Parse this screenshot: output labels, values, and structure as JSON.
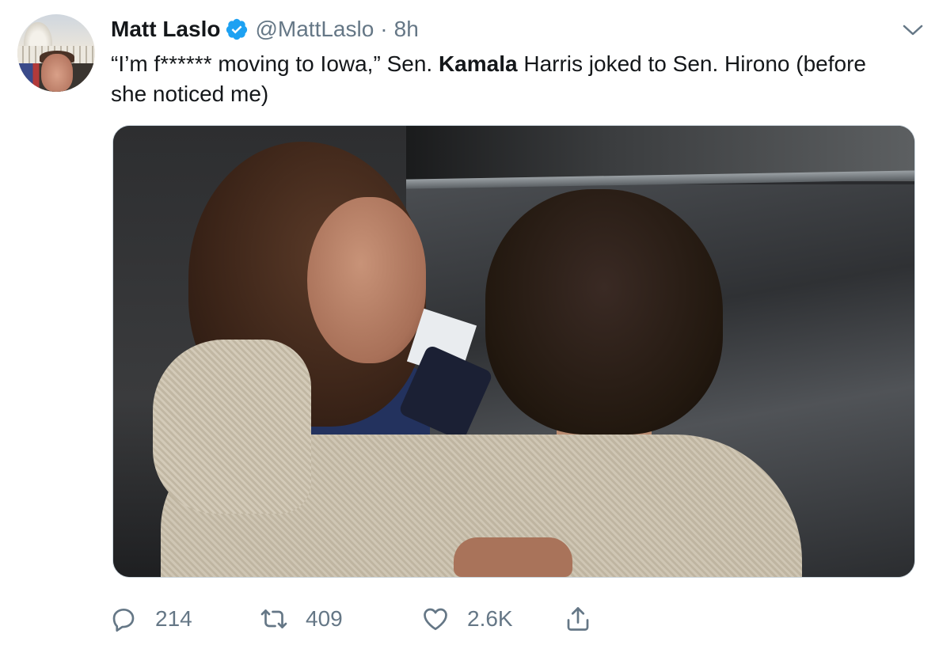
{
  "author": {
    "display_name": "Matt Laslo",
    "handle": "@MattLaslo",
    "separator": "·",
    "time": "8h",
    "verified": true
  },
  "tweet": {
    "text_before": "“I’m f****** moving to Iowa,” Sen. ",
    "text_bold": "Kamala",
    "text_after": " Harris joked to Sen. Hirono (before she noticed me)"
  },
  "actions": {
    "reply_count": "214",
    "retweet_count": "409",
    "like_count": "2.6K"
  },
  "icons": {
    "verified": "verified-badge-icon",
    "caret": "chevron-down-icon",
    "reply": "reply-icon",
    "retweet": "retweet-icon",
    "like": "heart-icon",
    "share": "share-icon"
  },
  "colors": {
    "text_primary": "#14171a",
    "text_secondary": "#657786",
    "verified_blue": "#1da1f2",
    "border": "#ccd6dd"
  }
}
